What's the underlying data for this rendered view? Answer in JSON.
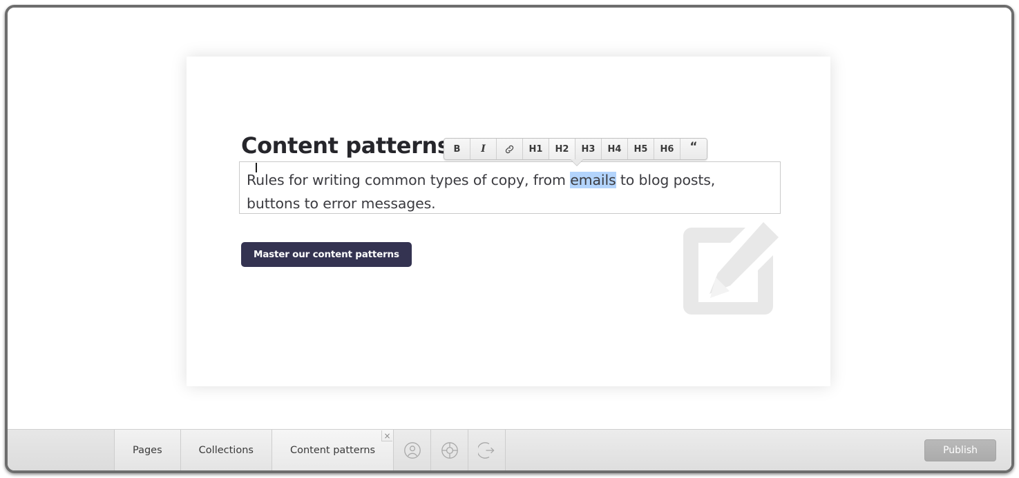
{
  "window": {
    "title": "Content patterns"
  },
  "page": {
    "heading": "Content patterns",
    "body_before": "Rules for writing common types of copy, from ",
    "body_selected": "emails",
    "body_after": " to blog posts, buttons to error messages.",
    "cta_label": "Master our content patterns",
    "watermark_icon": "edit-pencil-square-icon"
  },
  "format_toolbar": {
    "buttons": [
      {
        "label": "B",
        "name": "bold-button",
        "kind": "text",
        "active": false
      },
      {
        "label": "I",
        "name": "italic-button",
        "kind": "italic",
        "active": false
      },
      {
        "label": "",
        "name": "link-icon",
        "kind": "link",
        "active": false
      },
      {
        "label": "H1",
        "name": "heading-1-button",
        "kind": "text",
        "active": false
      },
      {
        "label": "H2",
        "name": "heading-2-button",
        "kind": "text",
        "active": true
      },
      {
        "label": "H3",
        "name": "heading-3-button",
        "kind": "text",
        "active": false
      },
      {
        "label": "H4",
        "name": "heading-4-button",
        "kind": "text",
        "active": false
      },
      {
        "label": "H5",
        "name": "heading-5-button",
        "kind": "text",
        "active": false
      },
      {
        "label": "H6",
        "name": "heading-6-button",
        "kind": "text",
        "active": false
      },
      {
        "label": "“",
        "name": "blockquote-button",
        "kind": "quote",
        "active": false
      }
    ]
  },
  "bottom_bar": {
    "tabs": [
      {
        "label": "Pages",
        "name": "tab-pages",
        "active": false,
        "closable": false
      },
      {
        "label": "Collections",
        "name": "tab-collections",
        "active": false,
        "closable": false
      },
      {
        "label": "Content patterns",
        "name": "tab-content-patterns",
        "active": true,
        "closable": true
      }
    ],
    "tab_close_label": "×",
    "icons": [
      {
        "name": "account-icon",
        "kind": "account"
      },
      {
        "name": "lifebuoy-help-icon",
        "kind": "lifebuoy"
      },
      {
        "name": "sign-out-icon",
        "kind": "signout"
      }
    ],
    "publish_label": "Publish"
  },
  "colors": {
    "cta_background": "#343351",
    "selection_highlight": "#b3d4fc",
    "watermark": "#e8e8e8",
    "bar_background": "#e4e4e4",
    "publish_background": "#b0b0b0"
  }
}
